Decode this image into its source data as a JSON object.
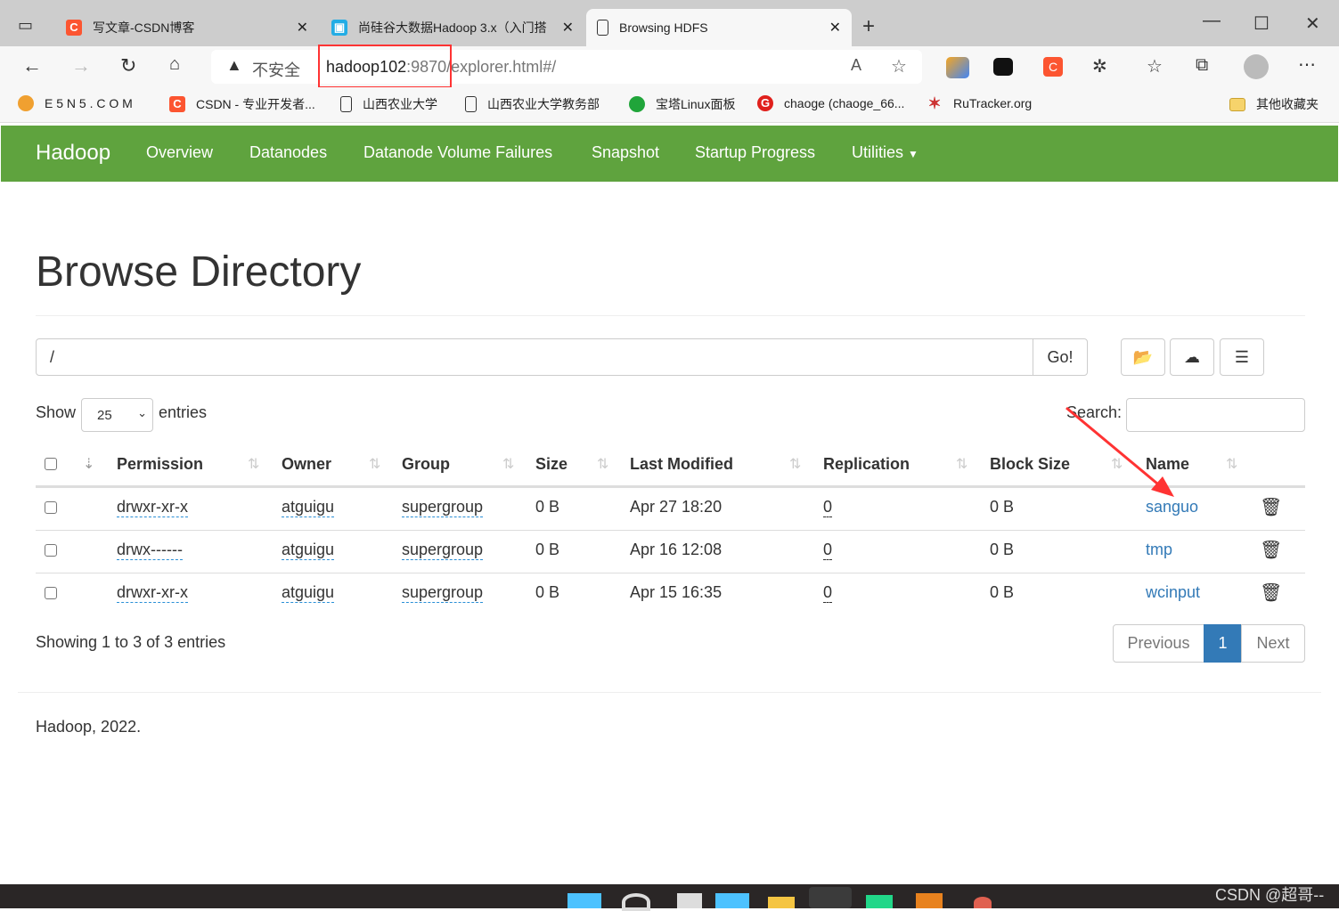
{
  "browser": {
    "tabs": [
      {
        "label": "写文章-CSDN博客",
        "icon": "csdn-icon"
      },
      {
        "label": "尚硅谷大数据Hadoop 3.x（入门搭",
        "icon": "bilibili-icon"
      },
      {
        "label": "Browsing HDFS",
        "icon": "page-icon",
        "active": true
      }
    ],
    "security": "不安全",
    "url_host": "hadoop102",
    "url_port": ":9870",
    "url_path": "/explorer.html#/",
    "bookmarks": [
      "E 5 N 5 . C O M",
      "CSDN - 专业开发者...",
      "山西农业大学",
      "山西农业大学教务部",
      "宝塔Linux面板",
      "chaoge (chaoge_66...",
      "RuTracker.org"
    ],
    "other_bookmarks": "其他收藏夹"
  },
  "navbar": {
    "brand": "Hadoop",
    "items": [
      "Overview",
      "Datanodes",
      "Datanode Volume Failures",
      "Snapshot",
      "Startup Progress",
      "Utilities"
    ]
  },
  "page": {
    "title": "Browse Directory",
    "path_value": "/",
    "go_label": "Go!",
    "show_label": "Show",
    "entries_value": "25",
    "entries_label": "entries",
    "search_label": "Search:",
    "search_value": ""
  },
  "table": {
    "headers": [
      "Permission",
      "Owner",
      "Group",
      "Size",
      "Last Modified",
      "Replication",
      "Block Size",
      "Name"
    ],
    "rows": [
      [
        "drwxr-xr-x",
        "atguigu",
        "supergroup",
        "0 B",
        "Apr 27 18:20",
        "0",
        "0 B",
        "sanguo"
      ],
      [
        "drwx------",
        "atguigu",
        "supergroup",
        "0 B",
        "Apr 16 12:08",
        "0",
        "0 B",
        "tmp"
      ],
      [
        "drwxr-xr-x",
        "atguigu",
        "supergroup",
        "0 B",
        "Apr 15 16:35",
        "0",
        "0 B",
        "wcinput"
      ]
    ]
  },
  "footer": {
    "info": "Showing 1 to 3 of 3 entries",
    "previous": "Previous",
    "page": "1",
    "next": "Next",
    "copyright": "Hadoop, 2022."
  },
  "watermark": "CSDN @超哥--",
  "colors": {
    "navbar": "#5fa33e",
    "link": "#337ab7",
    "active_page": "#337ab7",
    "annotation": "#ff3333"
  }
}
